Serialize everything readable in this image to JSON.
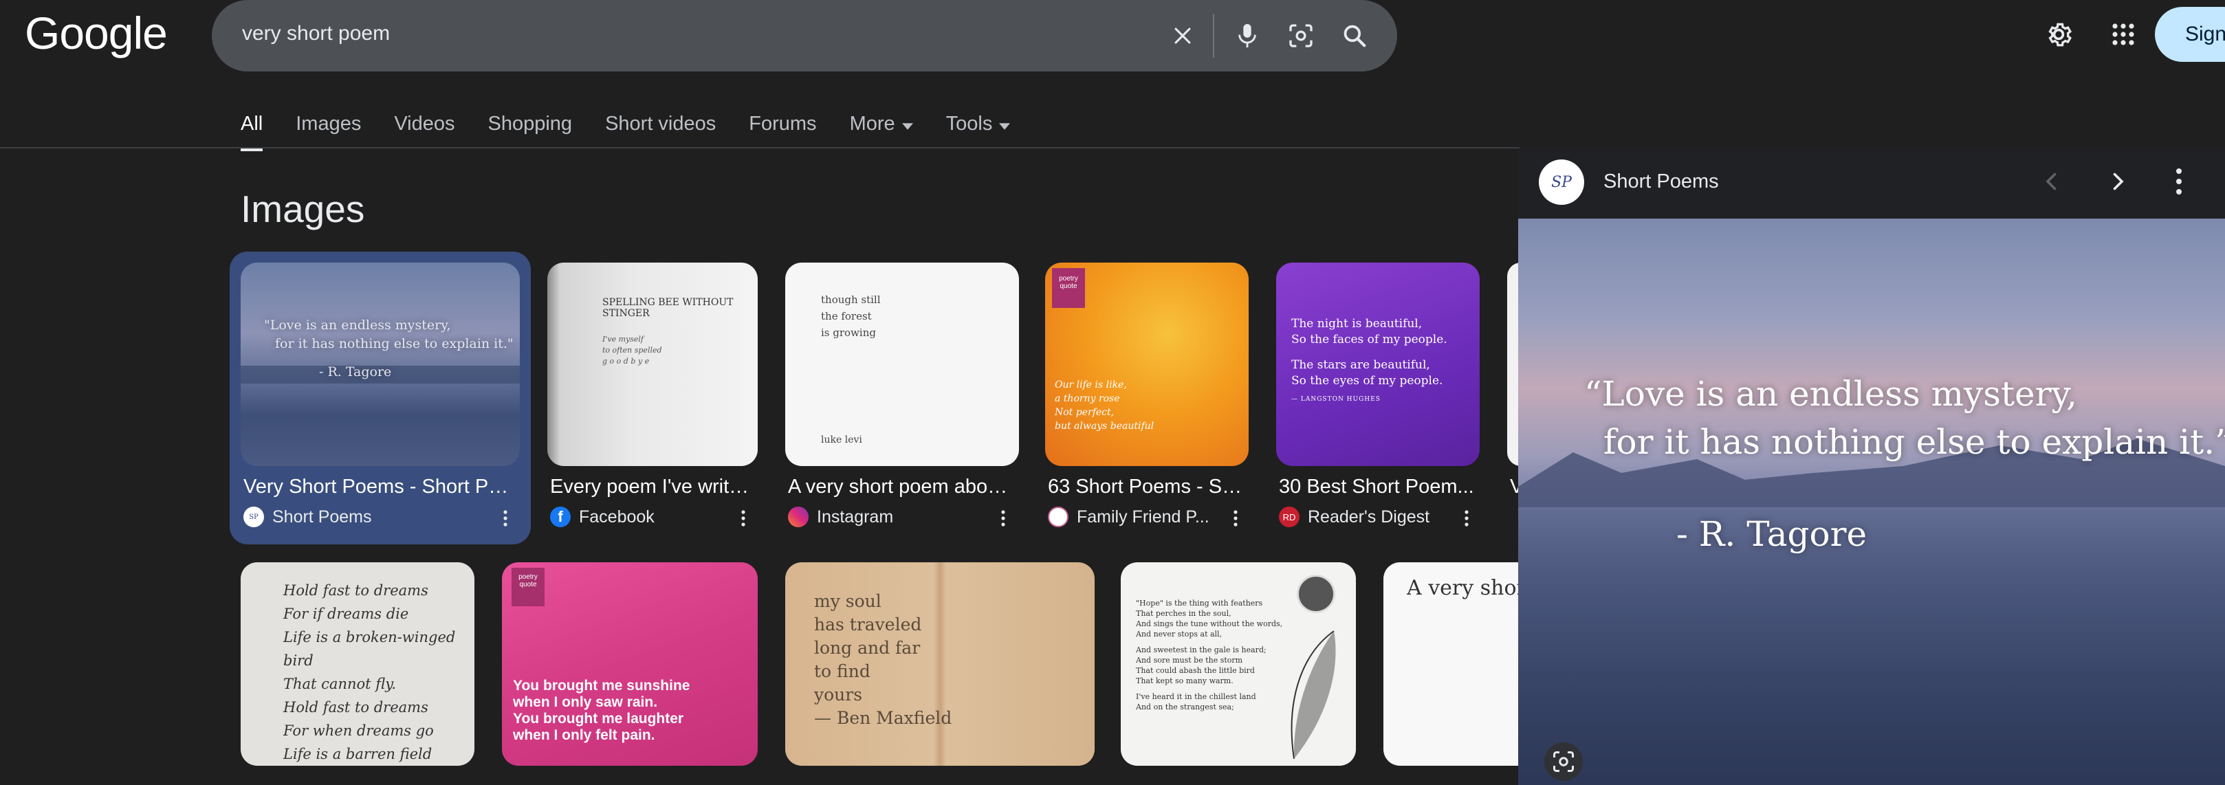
{
  "search": {
    "query": "very short poem"
  },
  "header": {
    "logo": "Google",
    "signin_label": "Sign"
  },
  "tabs": [
    {
      "label": "All",
      "active": true
    },
    {
      "label": "Images"
    },
    {
      "label": "Videos"
    },
    {
      "label": "Shopping"
    },
    {
      "label": "Short videos"
    },
    {
      "label": "Forums"
    },
    {
      "label": "More"
    },
    {
      "label": "Tools"
    }
  ],
  "section_title": "Images",
  "row1": [
    {
      "title": "Very Short Poems - Short Po...",
      "source": "Short Poems",
      "image_text": [
        "\"Love is an endless mystery,",
        "for it has nothing else to explain it.\"",
        "- R. Tagore"
      ]
    },
    {
      "title": "Every poem I've writt...",
      "source": "Facebook",
      "image_text": [
        "SPELLING BEE WITHOUT STINGER",
        "I've myself",
        "to often spelled",
        "g o o d b y e"
      ]
    },
    {
      "title": "A very short poem abou...",
      "source": "Instagram",
      "image_text": [
        "though still",
        "the forest",
        "is growing",
        "luke levi"
      ]
    },
    {
      "title": "63 Short Poems - Sh...",
      "source": "Family Friend P...",
      "image_text": [
        "poetry quote",
        "Our life is like,",
        "a thorny rose",
        "Not perfect,",
        "but always beautiful"
      ]
    },
    {
      "title": "30 Best Short Poem...",
      "source": "Reader's Digest",
      "image_text": [
        "The night is beautiful,",
        "So the faces of my people.",
        "The stars are beautiful,",
        "So the eyes of my people.",
        "— LANGSTON HUGHES"
      ]
    },
    {
      "title": "V",
      "source": ""
    }
  ],
  "row2": [
    {
      "image_text": [
        "Hold fast to dreams",
        "For if dreams die",
        "Life is a broken-winged bird",
        "That cannot fly.",
        "Hold fast to dreams",
        "For when dreams go",
        "Life is a barren field"
      ]
    },
    {
      "image_text": [
        "poetry quote",
        "You brought me sunshine",
        "when I only saw rain.",
        "You brought me laughter",
        "when I only felt pain."
      ]
    },
    {
      "image_text": [
        "my soul",
        "has traveled",
        "long and far",
        "to find",
        "yours",
        "— Ben Maxfield"
      ]
    },
    {
      "image_text": [
        "\"Hope\" is the thing with feathers",
        "That perches in the soul,",
        "And sings the tune without the words,",
        "And never stops at all,",
        "And sweetest in the gale is heard;",
        "And sore must be the storm",
        "That could abash the little bird",
        "That kept so many warm.",
        "I've heard it in the chillest land",
        "And on the strangest sea;"
      ]
    },
    {
      "image_text": [
        "A very short"
      ]
    }
  ],
  "panel": {
    "avatar_text": "SP",
    "title": "Short Poems",
    "quote_line1": "“Love is an endless mystery,",
    "quote_line2": "for it has nothing else to explain it.”",
    "quote_author": "- R. Tagore"
  },
  "colors": {
    "background": "#1f1f1f",
    "search_bg": "#4d5156",
    "selected_card": "#394e7e",
    "signin_bg": "#c2e7ff"
  }
}
